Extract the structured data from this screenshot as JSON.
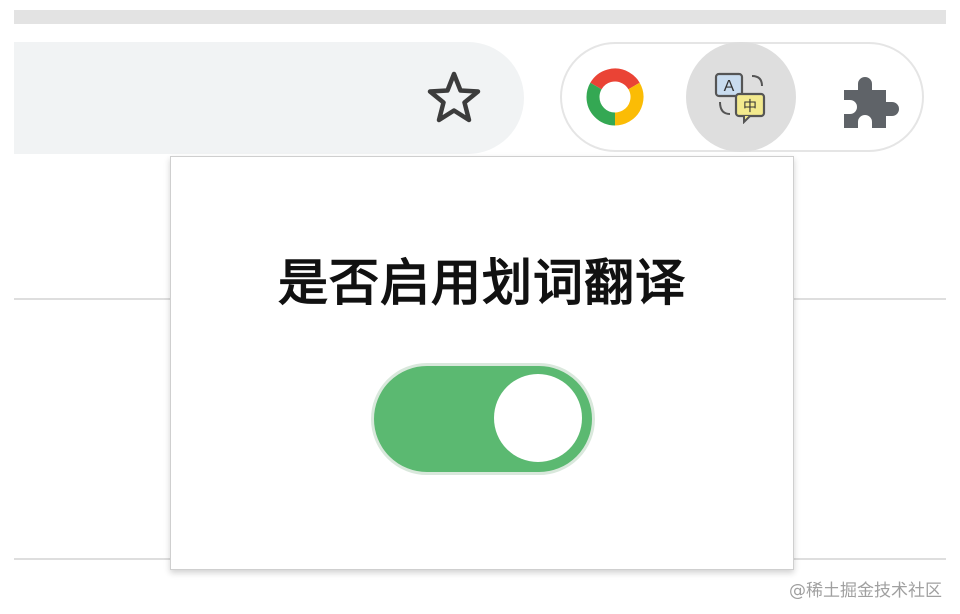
{
  "popup": {
    "title": "是否启用划词翻译",
    "toggle": {
      "on": true,
      "on_color": "#5bb971"
    }
  },
  "toolbar": {
    "icons": [
      "star-icon",
      "chrome-logo-icon",
      "translate-icon",
      "puzzle-icon"
    ],
    "translate_icon_labels": {
      "latin": "A",
      "chinese": "中"
    }
  },
  "watermark": "@稀土掘金技术社区"
}
